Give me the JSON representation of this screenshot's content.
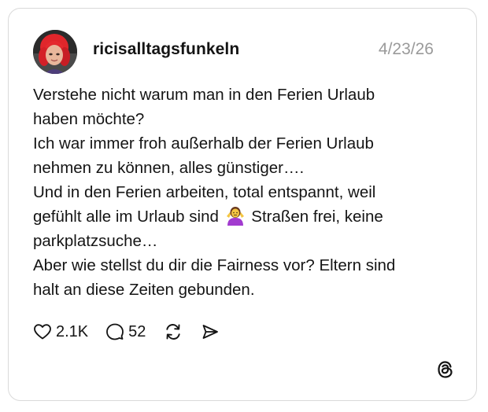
{
  "post": {
    "username": "ricisalltagsfunkeln",
    "date": "4/23/26",
    "lines": [
      "Verstehe nicht warum man in den Ferien Urlaub",
      "haben möchte?",
      "Ich war immer froh außerhalb der Ferien Urlaub",
      "nehmen zu können, alles günstiger….",
      "Und in den Ferien arbeiten, total entspannt, weil",
      "parkplatzsuche…",
      "Aber wie stellst du dir die Fairness vor? Eltern sind",
      "halt an diese Zeiten gebunden."
    ],
    "line6_before_emoji": "gefühlt alle im Urlaub sind",
    "line6_after_emoji": "Straßen frei, keine",
    "emoji": "person-shrugging-emoji"
  },
  "actions": {
    "likes": "2.1K",
    "replies": "52",
    "like_icon": "heart-icon",
    "reply_icon": "comment-icon",
    "repost_icon": "repost-icon",
    "share_icon": "send-icon"
  },
  "brand": {
    "logo": "threads-logo-icon"
  },
  "colors": {
    "text": "#141414",
    "muted": "#9a9a9a",
    "border": "#d9d9d9",
    "avatar_hair": "#e0262b"
  }
}
